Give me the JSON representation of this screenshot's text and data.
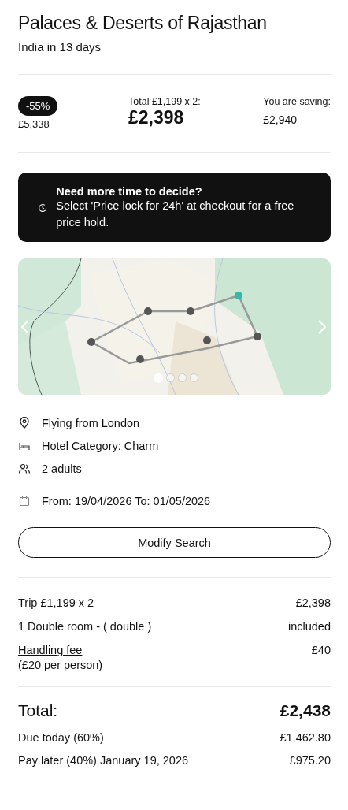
{
  "header": {
    "title": "Palaces & Deserts of Rajasthan",
    "subtitle": "India in 13 days"
  },
  "price": {
    "discount": "-55%",
    "old_price": "£5,338",
    "total_label": "Total £1,199 x 2:",
    "total": "£2,398",
    "saving_label": "You are saving:",
    "saving": "£2,940"
  },
  "notice": {
    "title": "Need more time to decide?",
    "text": "Select 'Price lock for 24h' at checkout for a free price hold."
  },
  "map": {
    "kind": "picture",
    "slides": [
      {
        "selected": true
      },
      {
        "selected": false
      },
      {
        "selected": false
      },
      {
        "selected": false
      }
    ]
  },
  "details": [
    {
      "kind": "location",
      "text": "Flying from London"
    },
    {
      "kind": "hotel",
      "text": "Hotel Category: Charm"
    },
    {
      "kind": "people",
      "text": "2 adults"
    },
    {
      "kind": "calendar",
      "text": "From: 19/04/2026  To: 01/05/2026"
    }
  ],
  "modify_button": "Modify Search",
  "lines": [
    {
      "kind": "plain",
      "label": "Trip £1,199 x 2",
      "value": "£2,398"
    },
    {
      "kind": "plain",
      "label": "1 Double room - ( double )",
      "value": "included"
    },
    {
      "kind": "link",
      "label": "Handling fee",
      "note": "(£20 per person)",
      "value": "£40"
    }
  ],
  "total": {
    "label": "Total:",
    "value": "£2,438"
  },
  "payments": [
    {
      "label": "Due today (60%)",
      "value": "£1,462.80"
    },
    {
      "label": "Pay later (40%) January 19, 2026",
      "value": "£975.20"
    }
  ]
}
